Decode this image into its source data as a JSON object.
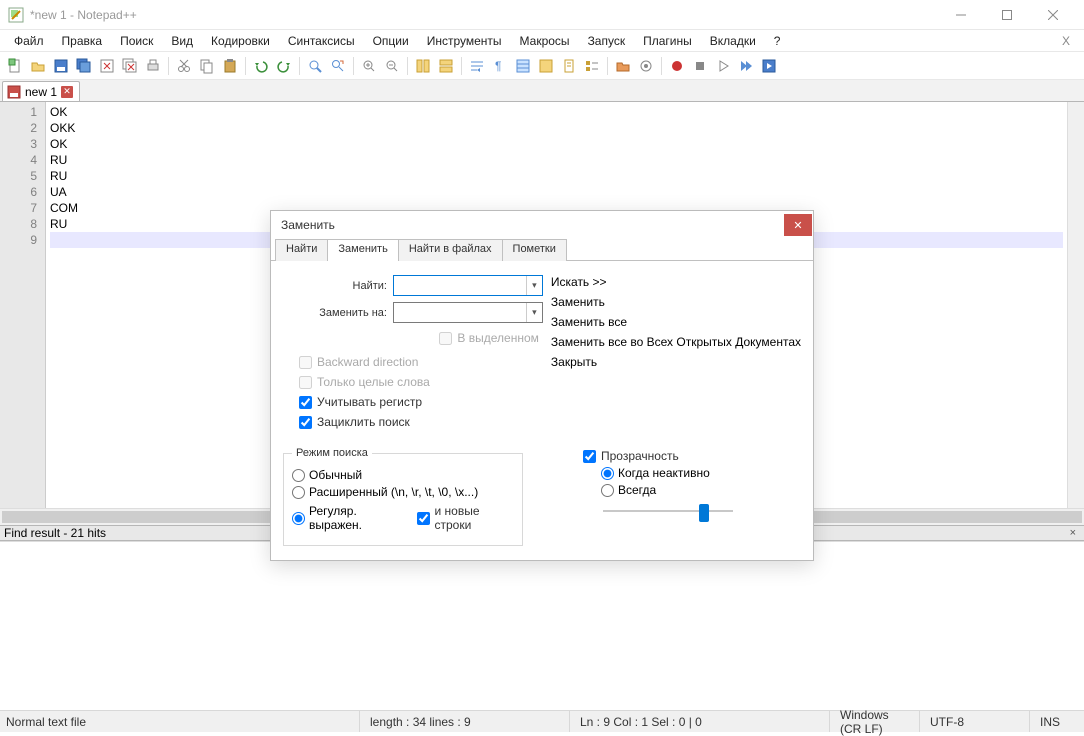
{
  "window": {
    "title": "*new 1 - Notepad++"
  },
  "menu": {
    "items": [
      "Файл",
      "Правка",
      "Поиск",
      "Вид",
      "Кодировки",
      "Синтаксисы",
      "Опции",
      "Инструменты",
      "Макросы",
      "Запуск",
      "Плагины",
      "Вкладки",
      "?"
    ]
  },
  "tab": {
    "name": "new 1"
  },
  "editor": {
    "lines": [
      "OK",
      "OKK",
      "OK",
      "RU",
      "RU",
      "UA",
      "COM",
      "RU",
      ""
    ],
    "current_line_index": 8
  },
  "findresult": {
    "label": "Find result - 21 hits"
  },
  "status": {
    "filetype": "Normal text file",
    "length_lines": "length : 34     lines : 9",
    "pos": "Ln : 9    Col : 1    Sel : 0 | 0",
    "eol": "Windows (CR LF)",
    "encoding": "UTF-8",
    "ins": "INS"
  },
  "dialog": {
    "title": "Заменить",
    "tabs": [
      "Найти",
      "Заменить",
      "Найти в файлах",
      "Пометки"
    ],
    "active_tab_index": 1,
    "find_label": "Найти:",
    "replace_label": "Заменить на:",
    "find_value": "",
    "replace_value": "",
    "in_selection": "В выделенном",
    "btn_findnext": "Искать >>",
    "btn_replace": "Заменить",
    "btn_replaceall": "Заменить все",
    "btn_replaceall_docs": "Заменить все во Всех Открытых Документах",
    "btn_close": "Закрыть",
    "chk_backward": "Backward direction",
    "chk_wholeword": "Только целые слова",
    "chk_matchcase": "Учитывать регистр",
    "chk_wrap": "Зациклить поиск",
    "group_mode": "Режим поиска",
    "radio_normal": "Обычный",
    "radio_extended": "Расширенный (\\n, \\r, \\t, \\0, \\x...)",
    "radio_regex": "Регуляр. выражен.",
    "chk_dotall": "и новые строки",
    "chk_transparency": "Прозрачность",
    "radio_onlose": "Когда неактивно",
    "radio_always": "Всегда"
  }
}
